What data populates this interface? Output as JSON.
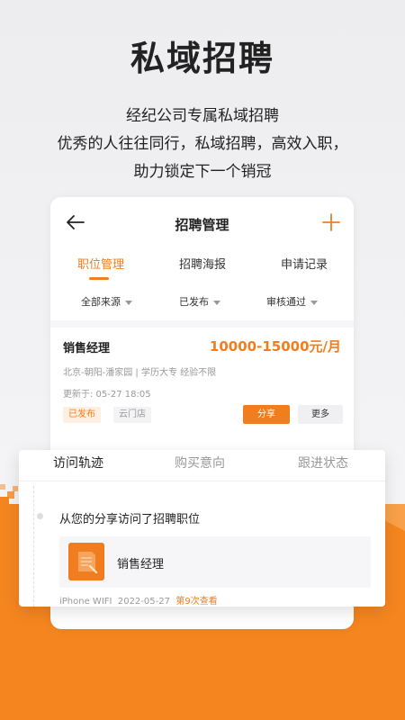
{
  "hero": {
    "title": "私域招聘",
    "line1": "经纪公司专属私域招聘",
    "line2": "优秀的人往往同行，私域招聘，高效入职，",
    "line3": "助力锁定下一个销冠"
  },
  "nav": {
    "title": "招聘管理"
  },
  "tabs": [
    "职位管理",
    "招聘海报",
    "申请记录"
  ],
  "filters": [
    "全部来源",
    "已发布",
    "审核通过"
  ],
  "job": {
    "title": "销售经理",
    "salary": "10000-15000元/月",
    "info": "北京-朝阳-潘家园 | 学历大专 经验不限",
    "updated": "更新于: 05-27 18:05",
    "badge_status": "已发布",
    "badge_store": "云门店",
    "share_label": "分享",
    "more_label": "更多"
  },
  "card": {
    "tabs": [
      "访问轨迹",
      "购买意向",
      "跟进状态"
    ],
    "visit_text": "从您的分享访问了招聘职位",
    "job_title": "销售经理",
    "device": "iPhone WIFI",
    "date": "2022-05-27",
    "times": "第9次查看"
  },
  "colors": {
    "accent": "#f07e1e",
    "text": "#222222",
    "muted": "#999999"
  }
}
